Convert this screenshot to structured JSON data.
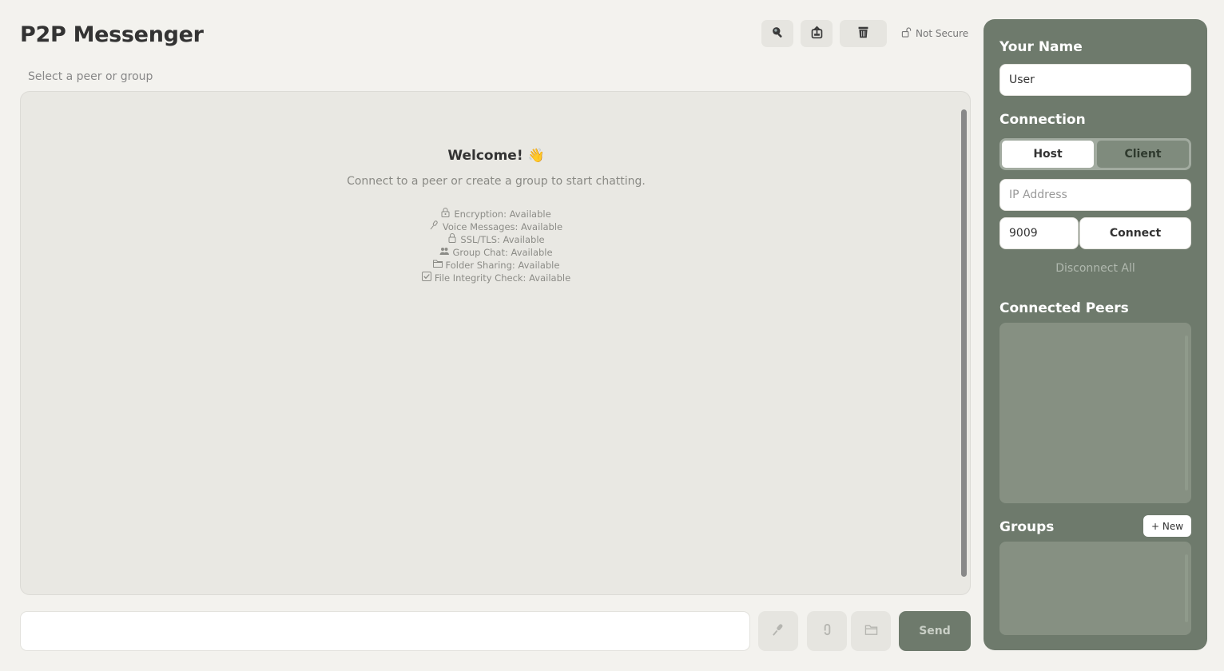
{
  "app": {
    "title": "P2P Messenger"
  },
  "header": {
    "security_status": "Not Secure",
    "tools": [
      "search-icon",
      "export-icon",
      "trash-icon"
    ]
  },
  "chat": {
    "target_label": "Select a peer or group",
    "welcome_title": "Welcome! 👋",
    "welcome_text": "Connect to a peer or create a group to start chatting.",
    "features": [
      {
        "icon": "lock-key-icon",
        "label": "Encryption: Available"
      },
      {
        "icon": "microphone-icon",
        "label": "Voice Messages: Available"
      },
      {
        "icon": "lock-icon",
        "label": "SSL/TLS: Available"
      },
      {
        "icon": "group-icon",
        "label": "Group Chat: Available"
      },
      {
        "icon": "folder-icon",
        "label": "Folder Sharing: Available"
      },
      {
        "icon": "check-box-icon",
        "label": "File Integrity Check: Available"
      }
    ]
  },
  "composer": {
    "message_value": "",
    "send_label": "Send",
    "actions": [
      "microphone-icon",
      "paperclip-icon",
      "folder-icon"
    ]
  },
  "sidebar": {
    "name_heading": "Your Name",
    "name_value": "User",
    "connection_heading": "Connection",
    "mode_host": "Host",
    "mode_client": "Client",
    "mode_selected": "Host",
    "ip_placeholder": "IP Address",
    "ip_value": "",
    "port_value": "9009",
    "connect_label": "Connect",
    "disconnect_label": "Disconnect All",
    "peers_heading": "Connected Peers",
    "groups_heading": "Groups",
    "new_group_label": "+ New"
  },
  "colors": {
    "background": "#f3f2ee",
    "sidebar": "#6e7a6c",
    "accent": "#6e7a6c",
    "chat_panel": "#e9e8e3"
  }
}
